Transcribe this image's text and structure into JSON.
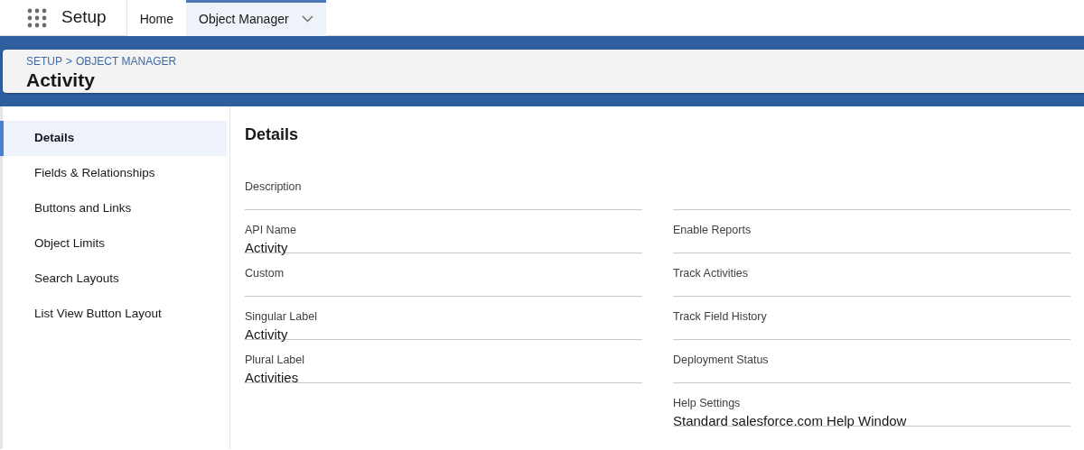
{
  "app": {
    "name": "Setup"
  },
  "nav_tabs": [
    {
      "label": "Home",
      "selected": false,
      "has_menu": false
    },
    {
      "label": "Object Manager",
      "selected": true,
      "has_menu": true
    }
  ],
  "header": {
    "breadcrumb": [
      "SETUP",
      "OBJECT MANAGER"
    ],
    "separator": ">",
    "title": "Activity"
  },
  "sidebar": {
    "items": [
      {
        "label": "Details",
        "selected": true
      },
      {
        "label": "Fields & Relationships",
        "selected": false
      },
      {
        "label": "Buttons and Links",
        "selected": false
      },
      {
        "label": "Object Limits",
        "selected": false
      },
      {
        "label": "Search Layouts",
        "selected": false
      },
      {
        "label": "List View Button Layout",
        "selected": false
      }
    ]
  },
  "details": {
    "title": "Details",
    "rows": [
      {
        "left": {
          "label": "Description"
        },
        "right": {}
      },
      {
        "left": {
          "label": "API Name",
          "value": "Activity"
        },
        "right": {
          "label": "Enable Reports"
        }
      },
      {
        "left": {
          "label": "Custom"
        },
        "right": {
          "label": "Track Activities"
        }
      },
      {
        "left": {
          "label": "Singular Label",
          "value": "Activity"
        },
        "right": {
          "label": "Track Field History"
        }
      },
      {
        "left": {
          "label": "Plural Label",
          "value": "Activities"
        },
        "right": {
          "label": "Deployment Status"
        }
      },
      {
        "right": {
          "label": "Help Settings",
          "value": "Standard salesforce.com Help Window"
        }
      }
    ]
  }
}
